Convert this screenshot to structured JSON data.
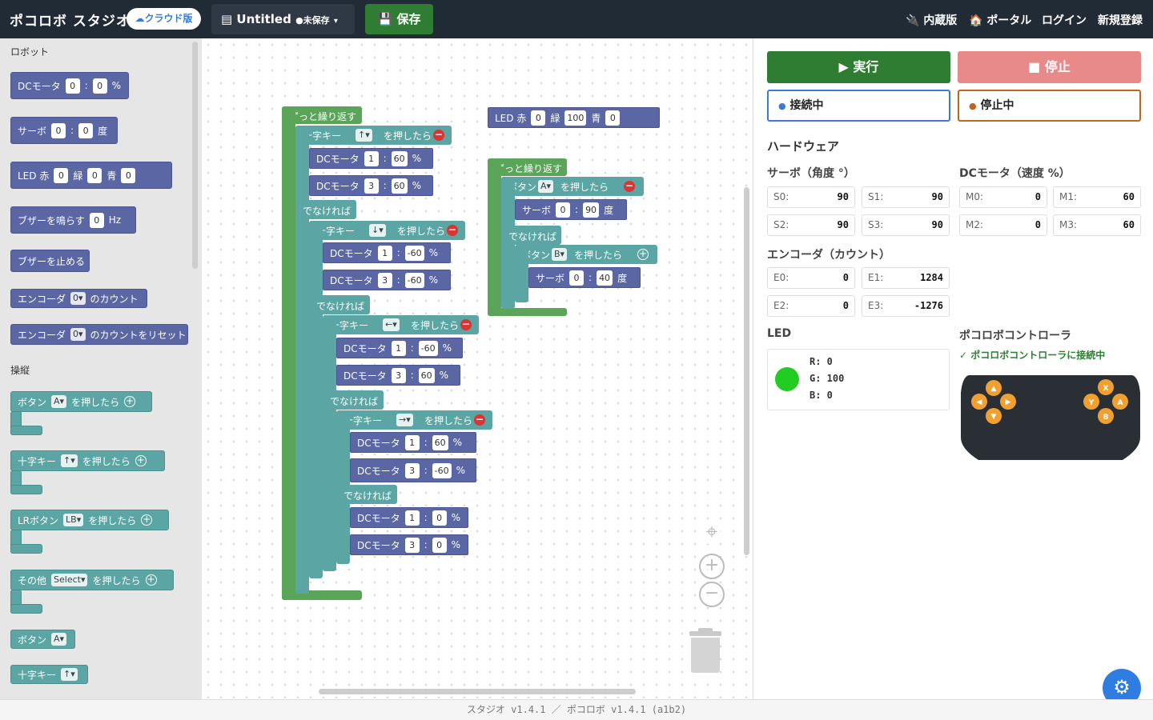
{
  "header": {
    "app_title": "ポコロボ スタジオ",
    "cloud_badge": "☁クラウド版",
    "project_name": "Untitled",
    "unsaved": "●未保存",
    "save_label": "保存",
    "nav": [
      "内蔵版",
      "ポータル",
      "ログイン",
      "新規登録"
    ]
  },
  "palette": {
    "category_robot": "ロボット",
    "category_control": "操縦",
    "dc_motor": {
      "label": "DCモータ",
      "port": "0",
      "value": "0",
      "unit": "%"
    },
    "servo": {
      "label": "サーボ",
      "port": "0",
      "value": "0",
      "unit": "度"
    },
    "led": {
      "label": "LED 赤",
      "r": "0",
      "g_label": "緑",
      "g": "0",
      "b_label": "青",
      "b": "0"
    },
    "buzzer": {
      "label": "ブザーを鳴らす",
      "value": "0",
      "unit": "Hz"
    },
    "buzzer_stop": "ブザーを止める",
    "encoder_count": {
      "label": "エンコーダ",
      "port": "0▾",
      "suffix": "のカウント"
    },
    "encoder_reset": {
      "label": "エンコーダ",
      "port": "0▾",
      "suffix": "のカウントをリセット"
    },
    "btn_pressed": {
      "label": "ボタン",
      "sel": "A▾",
      "suffix": "を押したら"
    },
    "dpad_pressed": {
      "label": "十字キー",
      "sel": "↑▾",
      "suffix": "を押したら"
    },
    "lr_pressed": {
      "label": "LRボタン",
      "sel": "LB▾",
      "suffix": "を押したら"
    },
    "other_pressed": {
      "label": "その他",
      "sel": "Select▾",
      "suffix": "を押したら"
    },
    "btn_value": {
      "label": "ボタン",
      "sel": "A▾"
    },
    "dpad_value": {
      "label": "十字キー",
      "sel": "↑▾"
    }
  },
  "workspace": {
    "loop": "ずっと繰り返す",
    "dpad": "十字キー",
    "pressed": "を押したら",
    "else": "でなければ",
    "dc": "DCモータ",
    "servo": "サーボ",
    "pct": "%",
    "deg": "度",
    "button": "ボタン",
    "stackA": [
      {
        "dir": "↑▾",
        "m1": "60",
        "m3": "60"
      },
      {
        "dir": "↓▾",
        "m1": "-60",
        "m3": "-60"
      },
      {
        "dir": "←▾",
        "m1": "-60",
        "m3": "60"
      },
      {
        "dir": "→▾",
        "m1": "60",
        "m3": "-60"
      }
    ],
    "stackA_final": {
      "m1": "0",
      "m3": "0"
    },
    "ports": {
      "p1": "1",
      "p3": "3",
      "p0": "0"
    },
    "led_block": {
      "r_label": "LED 赤",
      "r": "0",
      "g_label": "緑",
      "g": "100",
      "b_label": "青",
      "b": "0"
    },
    "stackB": {
      "btn1": "A▾",
      "servo1": "90",
      "btn2": "B▾",
      "servo2": "40"
    }
  },
  "panel": {
    "run": "▶ 実行",
    "stop": "■ 停止",
    "connected": "接続中",
    "stopped": "停止中",
    "hardware": "ハードウェア",
    "servo_title": "サーボ（角度 °）",
    "dc_title": "DCモータ（速度 %）",
    "servo": [
      {
        "k": "S0:",
        "v": "90"
      },
      {
        "k": "S1:",
        "v": "90"
      },
      {
        "k": "S2:",
        "v": "90"
      },
      {
        "k": "S3:",
        "v": "90"
      }
    ],
    "dc": [
      {
        "k": "M0:",
        "v": "0"
      },
      {
        "k": "M1:",
        "v": "60"
      },
      {
        "k": "M2:",
        "v": "0"
      },
      {
        "k": "M3:",
        "v": "60"
      }
    ],
    "enc_title": "エンコーダ（カウント）",
    "enc": [
      {
        "k": "E0:",
        "v": "0"
      },
      {
        "k": "E1:",
        "v": "1284"
      },
      {
        "k": "E2:",
        "v": "0"
      },
      {
        "k": "E3:",
        "v": "-1276"
      }
    ],
    "led_title": "LED",
    "led_r": "R: 0",
    "led_g": "G: 100",
    "led_b": "B: 0",
    "led_color": "#22cc22",
    "ctrl_title": "ポコロボコントローラ",
    "ctrl_status": "✓ ポコロボコントローラに接続中",
    "ctrl_buttons": {
      "x": "X",
      "y": "Y",
      "a": "A",
      "b": "B"
    }
  },
  "footer": "スタジオ v1.4.1 ／ ポコロボ v1.4.1 (a1b2)",
  "colors": {
    "header": "#212b36",
    "run": "#2e7d32",
    "stop": "#e88a8a",
    "connected": "#3a7bd5",
    "stopped": "#c0651d",
    "accent": "#2f7de1"
  }
}
